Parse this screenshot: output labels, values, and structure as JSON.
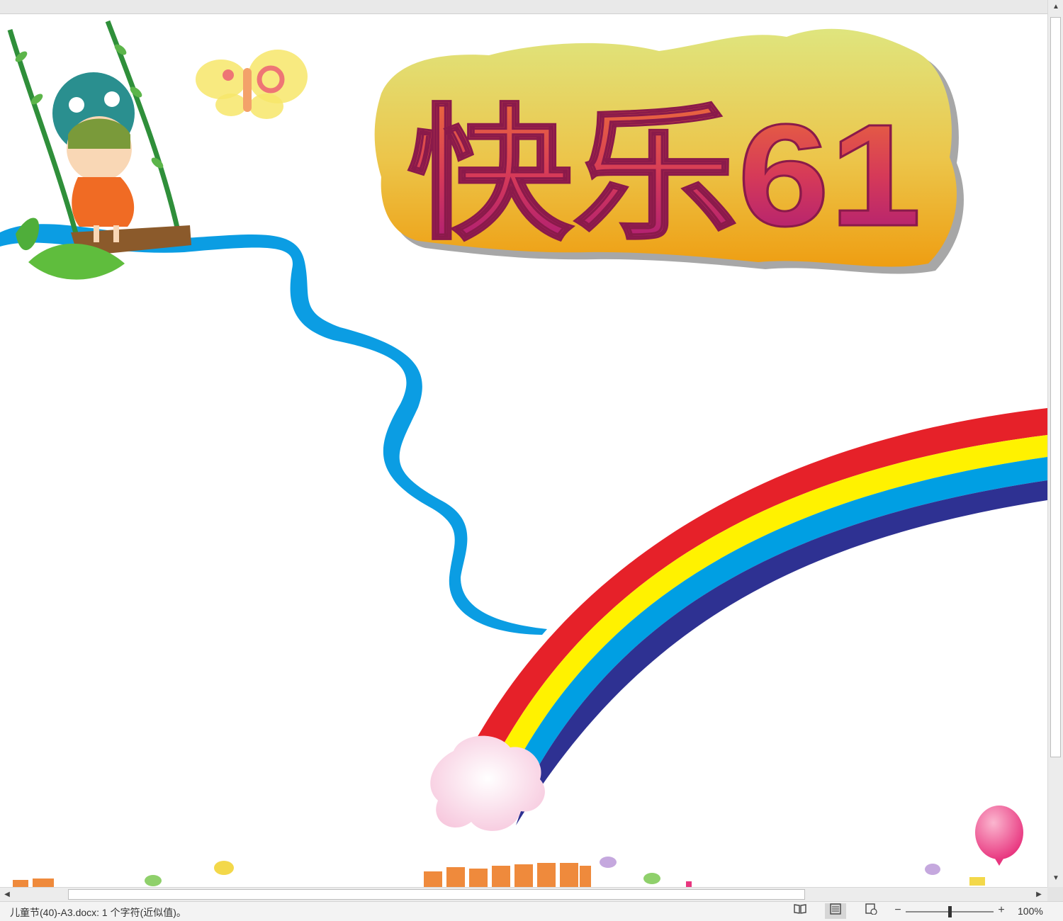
{
  "document": {
    "headline": "快乐61"
  },
  "statusbar": {
    "doc_status": "儿童节(40)-A3.docx: 1 个字符(近似值)。",
    "zoom_level": "100%",
    "zoom_fraction": 0.5,
    "zoom_minus_label": "−",
    "zoom_plus_label": "+"
  },
  "icons": {
    "read_mode": "book-icon",
    "print_layout": "page-icon",
    "web_layout": "web-icon"
  },
  "colors": {
    "river": "#0b9de3",
    "rainbow_red": "#e62129",
    "rainbow_yellow": "#fff200",
    "rainbow_blue": "#009fe3",
    "rainbow_indigo": "#2e3192",
    "sign_top": "#d9e27a",
    "sign_bottom": "#eea016",
    "title_text": "#d9445b"
  }
}
